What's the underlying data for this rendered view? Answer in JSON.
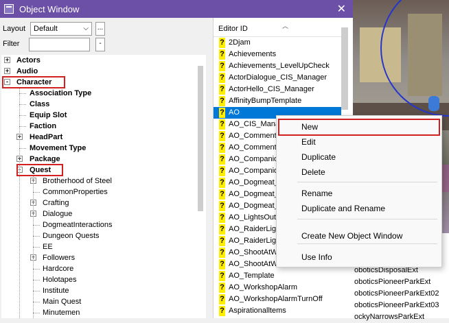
{
  "window": {
    "title": "Object Window",
    "close_glyph": "✕",
    "icon": "window-app-icon"
  },
  "controls": {
    "layout_label": "Layout",
    "layout_value": "Default",
    "layout_more": "...",
    "filter_label": "Filter",
    "filter_value": "",
    "filter_btn": "-"
  },
  "tree": {
    "items": [
      {
        "label": "Actors",
        "level": 0,
        "expander": "+",
        "bold": true
      },
      {
        "label": "Audio",
        "level": 0,
        "expander": "+",
        "bold": true
      },
      {
        "label": "Character",
        "level": 0,
        "expander": "-",
        "bold": true
      },
      {
        "label": "Association Type",
        "level": 1,
        "expander": "",
        "bold": true
      },
      {
        "label": "Class",
        "level": 1,
        "expander": "",
        "bold": true
      },
      {
        "label": "Equip Slot",
        "level": 1,
        "expander": "",
        "bold": true
      },
      {
        "label": "Faction",
        "level": 1,
        "expander": "",
        "bold": true
      },
      {
        "label": "HeadPart",
        "level": 1,
        "expander": "+",
        "bold": true
      },
      {
        "label": "Movement Type",
        "level": 1,
        "expander": "",
        "bold": true
      },
      {
        "label": "Package",
        "level": 1,
        "expander": "+",
        "bold": true
      },
      {
        "label": "Quest",
        "level": 1,
        "expander": "-",
        "bold": true
      },
      {
        "label": "Brotherhood of Steel",
        "level": 2,
        "expander": "+",
        "bold": false
      },
      {
        "label": "CommonProperties",
        "level": 2,
        "expander": "",
        "bold": false
      },
      {
        "label": "Crafting",
        "level": 2,
        "expander": "+",
        "bold": false
      },
      {
        "label": "Dialogue",
        "level": 2,
        "expander": "+",
        "bold": false
      },
      {
        "label": "DogmeatInteractions",
        "level": 2,
        "expander": "",
        "bold": false
      },
      {
        "label": "Dungeon Quests",
        "level": 2,
        "expander": "",
        "bold": false
      },
      {
        "label": "EE",
        "level": 2,
        "expander": "",
        "bold": false
      },
      {
        "label": "Followers",
        "level": 2,
        "expander": "+",
        "bold": false
      },
      {
        "label": "Hardcore",
        "level": 2,
        "expander": "",
        "bold": false
      },
      {
        "label": "Holotapes",
        "level": 2,
        "expander": "",
        "bold": false
      },
      {
        "label": "Institute",
        "level": 2,
        "expander": "",
        "bold": false
      },
      {
        "label": "Main Quest",
        "level": 2,
        "expander": "",
        "bold": false
      },
      {
        "label": "Minutemen",
        "level": 2,
        "expander": "",
        "bold": false
      }
    ]
  },
  "list": {
    "header": "Editor ID",
    "sort_glyph": "︿",
    "icon_glyph": "?",
    "selected_index": 6,
    "items": [
      "2Djam",
      "Achievements",
      "Achievements_LevelUpCheck",
      "ActorDialogue_CIS_Manager",
      "ActorHello_CIS_Manager",
      "AffinityBumpTemplate",
      "AO",
      "AO_CIS_Mana",
      "AO_Comment",
      "AO_Comment_",
      "AO_Companio",
      "AO_Companio",
      "AO_Dogmeat_",
      "AO_Dogmeat_",
      "AO_Dogmeat_",
      "AO_LightsOut",
      "AO_RaiderLigl",
      "AO_RaiderLigl",
      "AO_ShootAtW",
      "AO_ShootAtW",
      "AO_Template",
      "AO_WorkshopAlarm",
      "AO_WorkshopAlarmTurnOff",
      "Aspirationalltems"
    ]
  },
  "context_menu": {
    "items": [
      {
        "label": "New",
        "highlight": true
      },
      {
        "label": "Edit"
      },
      {
        "label": "Duplicate"
      },
      {
        "label": "Delete"
      },
      {
        "label": "Rename"
      },
      {
        "label": "Duplicate and Rename"
      },
      {
        "label": "Create New Object Window"
      },
      {
        "label": "Use Info"
      }
    ]
  },
  "right_list": {
    "items": [
      "oboticsDisposalExt",
      "oboticsPioneerParkExt",
      "oboticsPioneerParkExt02",
      "oboticsPioneerParkExt03",
      "ockyNarrowsParkExt"
    ]
  }
}
